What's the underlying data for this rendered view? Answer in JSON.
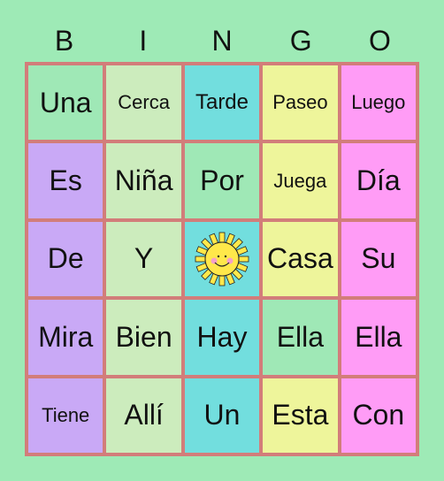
{
  "header": [
    "B",
    "I",
    "N",
    "G",
    "O"
  ],
  "colors": {
    "green": "#9fe8b6",
    "lightgreen": "#ccecbd",
    "cyan": "#72dede",
    "yellow": "#eef59b",
    "pink": "#ff9cf6",
    "purple": "#c9a9f6"
  },
  "cells": [
    {
      "text": "Una",
      "color": "green"
    },
    {
      "text": "Cerca",
      "color": "lightgreen",
      "size": "xs"
    },
    {
      "text": "Tarde",
      "color": "cyan",
      "size": "s"
    },
    {
      "text": "Paseo",
      "color": "yellow",
      "size": "xs"
    },
    {
      "text": "Luego",
      "color": "pink",
      "size": "xs"
    },
    {
      "text": "Es",
      "color": "purple"
    },
    {
      "text": "Niña",
      "color": "lightgreen"
    },
    {
      "text": "Por",
      "color": "green"
    },
    {
      "text": "Juega",
      "color": "yellow",
      "size": "xs"
    },
    {
      "text": "Día",
      "color": "pink"
    },
    {
      "text": "De",
      "color": "purple"
    },
    {
      "text": "Y",
      "color": "lightgreen"
    },
    {
      "text": "",
      "color": "cyan",
      "icon": "sun-icon"
    },
    {
      "text": "Casa",
      "color": "yellow"
    },
    {
      "text": "Su",
      "color": "pink"
    },
    {
      "text": "Mira",
      "color": "purple"
    },
    {
      "text": "Bien",
      "color": "lightgreen"
    },
    {
      "text": "Hay",
      "color": "cyan"
    },
    {
      "text": "Ella",
      "color": "green"
    },
    {
      "text": "Ella",
      "color": "pink"
    },
    {
      "text": "Tiene",
      "color": "purple",
      "size": "xs"
    },
    {
      "text": "Allí",
      "color": "lightgreen"
    },
    {
      "text": "Un",
      "color": "cyan"
    },
    {
      "text": "Esta",
      "color": "yellow"
    },
    {
      "text": "Con",
      "color": "pink"
    }
  ]
}
